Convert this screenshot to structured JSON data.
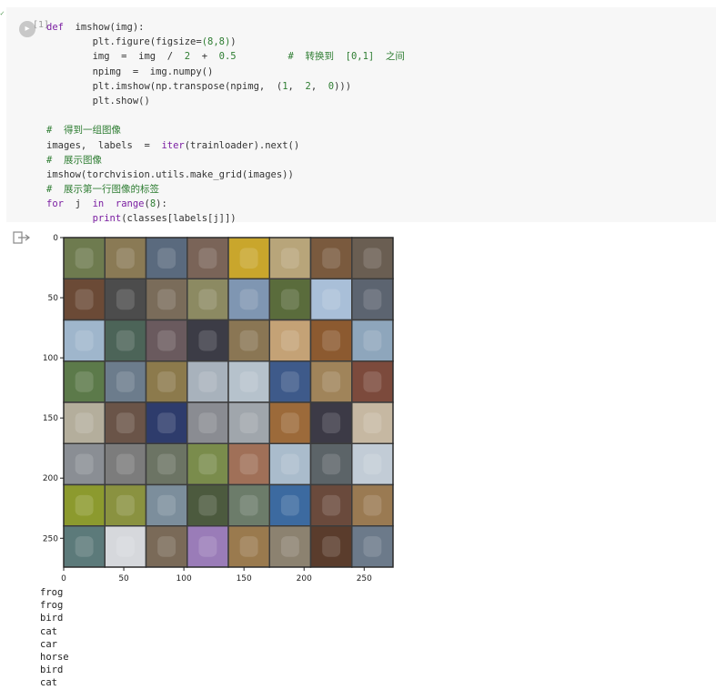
{
  "cell": {
    "exec_count": "[1]",
    "lines": [
      [
        {
          "t": "def",
          "c": "kw"
        },
        {
          "t": "  imshow(img):"
        }
      ],
      [
        {
          "t": "        plt.figure(figsize="
        },
        {
          "t": "(8,8)",
          "c": "num"
        },
        {
          "t": ")"
        }
      ],
      [
        {
          "t": "        img  =  img  /  "
        },
        {
          "t": "2",
          "c": "num"
        },
        {
          "t": "  +  "
        },
        {
          "t": "0.5",
          "c": "num"
        },
        {
          "t": "         "
        },
        {
          "t": "#  转换到  [0,1]  之间",
          "c": "cm"
        }
      ],
      [
        {
          "t": "        npimg  =  img.numpy()"
        }
      ],
      [
        {
          "t": "        plt.imshow(np.transpose(npimg,  ("
        },
        {
          "t": "1",
          "c": "num"
        },
        {
          "t": ",  "
        },
        {
          "t": "2",
          "c": "num"
        },
        {
          "t": ",  "
        },
        {
          "t": "0",
          "c": "num"
        },
        {
          "t": ")))"
        }
      ],
      [
        {
          "t": "        plt.show()"
        }
      ],
      [
        {
          "t": ""
        }
      ],
      [
        {
          "t": "#  得到一组图像",
          "c": "cm"
        }
      ],
      [
        {
          "t": "images,  labels  =  "
        },
        {
          "t": "iter",
          "c": "bi"
        },
        {
          "t": "(trainloader).next()"
        }
      ],
      [
        {
          "t": "#  展示图像",
          "c": "cm"
        }
      ],
      [
        {
          "t": "imshow(torchvision.utils.make_grid(images))"
        }
      ],
      [
        {
          "t": "#  展示第一行图像的标签",
          "c": "cm"
        }
      ],
      [
        {
          "t": "for",
          "c": "kw"
        },
        {
          "t": "  j  "
        },
        {
          "t": "in",
          "c": "kw"
        },
        {
          "t": "  "
        },
        {
          "t": "range",
          "c": "bi"
        },
        {
          "t": "("
        },
        {
          "t": "8",
          "c": "num"
        },
        {
          "t": "):"
        }
      ],
      [
        {
          "t": "        "
        },
        {
          "t": "print",
          "c": "bi"
        },
        {
          "t": "(classes[labels[j]])"
        }
      ]
    ]
  },
  "output": {
    "icon": "output-redirect-icon",
    "plot": {
      "x_ticks": [
        "0",
        "50",
        "100",
        "150",
        "200",
        "250"
      ],
      "y_ticks": [
        "0",
        "50",
        "100",
        "150",
        "200",
        "250"
      ],
      "grid_rows": 8,
      "grid_cols": 8,
      "tile_colors": [
        [
          "#6e7b4f",
          "#8a7a55",
          "#5a6a7e",
          "#7a6458",
          "#c9a62c",
          "#b8a57a",
          "#7a5a3e",
          "#6a5e52"
        ],
        [
          "#6b4a36",
          "#4c4c4c",
          "#7a6c5a",
          "#8c8a62",
          "#7f96b2",
          "#5a6c3c",
          "#a9bfd8",
          "#5c6470"
        ],
        [
          "#9fb6cc",
          "#4c6458",
          "#6a5a5e",
          "#3c3c46",
          "#8a7654",
          "#c4a276",
          "#8c5a30",
          "#8ea6bc"
        ],
        [
          "#5c7a4a",
          "#6c7c8c",
          "#8c7a4c",
          "#a8b2bc",
          "#b6c2cc",
          "#3e5a8a",
          "#a0845a",
          "#7c4a3c"
        ],
        [
          "#b4ae9c",
          "#6a5448",
          "#2e3c6c",
          "#8a8c92",
          "#a0a6ac",
          "#9c6a3a",
          "#3c3a46",
          "#c6b8a2"
        ],
        [
          "#8a8e94",
          "#7c7c7c",
          "#6c7464",
          "#7a8c4c",
          "#a07058",
          "#aabccc",
          "#5c6468",
          "#c2ccd6"
        ],
        [
          "#8c9a2e",
          "#8a9240",
          "#7c8e9c",
          "#4c5a3e",
          "#6c7c6a",
          "#3c6aa0",
          "#6a4a3c",
          "#9a7a52"
        ],
        [
          "#5c7a7a",
          "#d6d8dc",
          "#7a6a58",
          "#9a7cb8",
          "#9a7a4e",
          "#8c8270",
          "#5a3c2c",
          "#6c7a8a"
        ]
      ]
    },
    "printed": [
      "frog",
      "frog",
      "bird",
      "cat",
      "car",
      "horse",
      "bird",
      "cat"
    ]
  }
}
